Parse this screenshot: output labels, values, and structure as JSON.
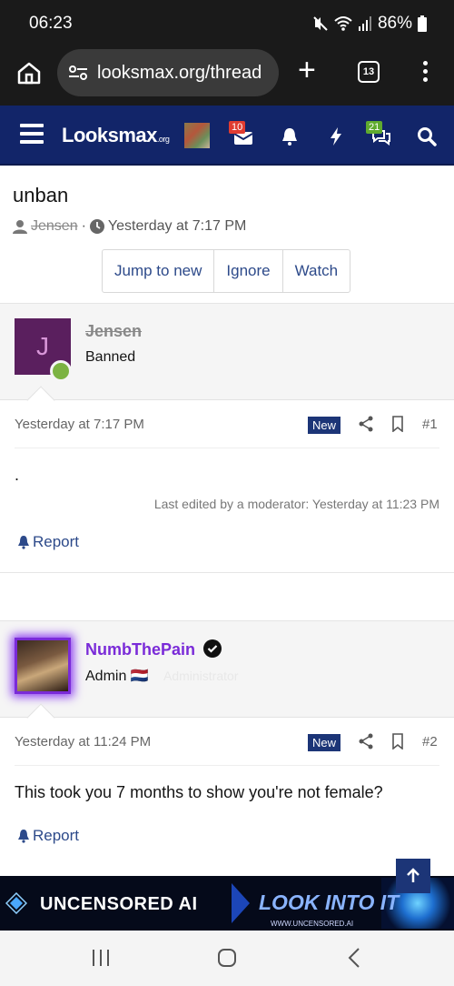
{
  "status": {
    "time": "06:23",
    "battery": "86%"
  },
  "browser": {
    "url": "looksmax.org/thread",
    "tab_count": "13"
  },
  "site": {
    "logo_main": "Lo",
    "logo_mid": "o",
    "logo_rest": "ksmax",
    "logo_suffix": ".org",
    "alerts_badge": "10",
    "conversations_badge": "21"
  },
  "thread": {
    "title": "unban",
    "author": "Jensen",
    "date": "Yesterday at 7:17 PM",
    "buttons": [
      "Jump to new",
      "Ignore",
      "Watch"
    ]
  },
  "posts": [
    {
      "username": "Jensen",
      "avatar_letter": "J",
      "user_title": "Banned",
      "date": "Yesterday at 7:17 PM",
      "new_label": "New",
      "number": "#1",
      "body": ".",
      "edited": "Last edited by a moderator: Yesterday at 11:23 PM",
      "report": "Report"
    },
    {
      "username": "NumbThePain",
      "user_title": "Admin 🇳🇱",
      "user_role_faded": "Administrator",
      "date": "Yesterday at 11:24 PM",
      "new_label": "New",
      "number": "#2",
      "body": "This took you 7 months to show you're not female?",
      "report": "Report"
    }
  ],
  "ad": {
    "left": "UNCENSORED AI",
    "right": "LOOK INTO IT",
    "site": "WWW.UNCENSORED.AI"
  },
  "colors": {
    "nav": "#122569",
    "link": "#2d4a8a",
    "admin": "#7a2bd8"
  }
}
